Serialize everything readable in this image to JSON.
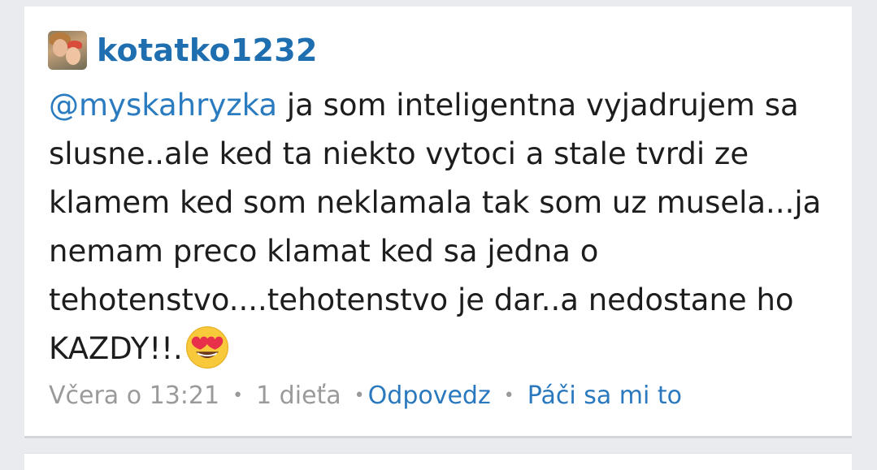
{
  "post": {
    "author": "kotatko1232",
    "avatar_icon": "user-avatar-photo",
    "mention": "@myskahryzka",
    "text": " ja som inteligentna vyjadrujem sa slusne..ale ked ta niekto vytoci a stale tvrdi ze klamem ked som neklamala tak som uz musela...ja nemam preco klamat ked sa jedna o tehotenstvo....tehotenstvo je dar..a nedostane ho KAZDY!!.",
    "emoji_icon": "heart-eyes-emoji-icon",
    "timestamp": "Včera o 13:21",
    "category": "1 dieťa",
    "separator": "•",
    "reply_label": "Odpovedz",
    "like_label": "Páči sa mi to"
  },
  "colors": {
    "username": "#1f6fb0",
    "link": "#2a78bd",
    "text": "#1d1d1d",
    "meta": "#9a9a9a",
    "background": "#e9ebee",
    "card": "#ffffff"
  }
}
